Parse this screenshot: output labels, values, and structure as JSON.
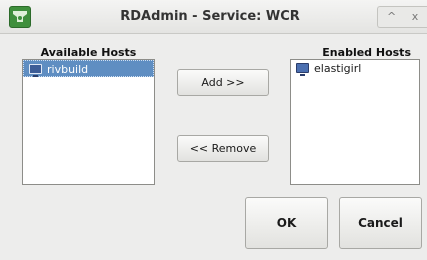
{
  "window": {
    "title": "RDAdmin - Service: WCR",
    "controls": "^ x",
    "app_icon": "rdadmin-app-icon"
  },
  "available_hosts": {
    "label": "Available Hosts",
    "items": [
      {
        "name": "rivbuild",
        "icon": "monitor-icon",
        "selected": true
      }
    ]
  },
  "enabled_hosts": {
    "label": "Enabled Hosts",
    "items": [
      {
        "name": "elastigirl",
        "icon": "monitor-icon",
        "selected": false
      }
    ]
  },
  "buttons": {
    "add": "Add >>",
    "remove": "<< Remove",
    "ok": "OK",
    "cancel": "Cancel"
  },
  "colors": {
    "selection": "#5f8ec2",
    "app_icon": "#3f8f3c"
  }
}
